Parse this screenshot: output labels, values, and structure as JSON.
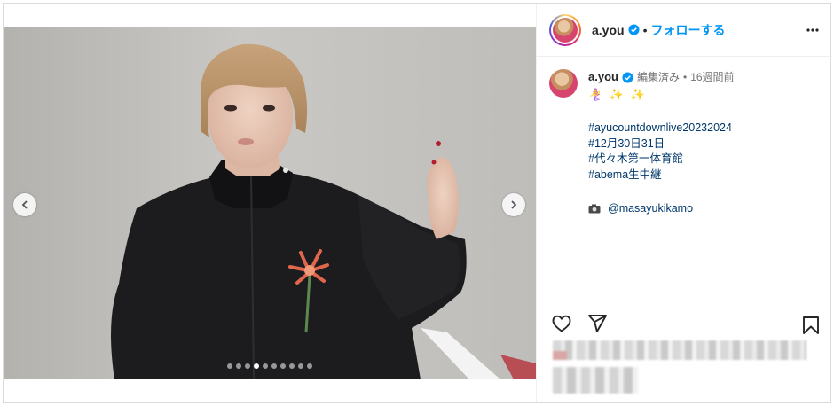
{
  "post": {
    "username": "a.you",
    "separator": "•",
    "follow_label": "フォローする",
    "more_icon": "more-horizontal-icon"
  },
  "caption": {
    "username": "a.you",
    "edited": "編集済み",
    "dot": "•",
    "time_ago": "16週間前",
    "emoji_line": "🧜‍♀️ ✨ ✨",
    "hashtags": [
      "#ayucountdownlive20232024",
      "#12月30日31日",
      "#代々木第一体育館",
      "#abema生中継"
    ],
    "credit": "@masayukikamo",
    "credit_icon": "camera-icon"
  },
  "carousel": {
    "total_slides": 10,
    "active_index": 3
  },
  "colors": {
    "accent": "#0095f6",
    "link": "#00376b",
    "verified": "#0095f6"
  }
}
